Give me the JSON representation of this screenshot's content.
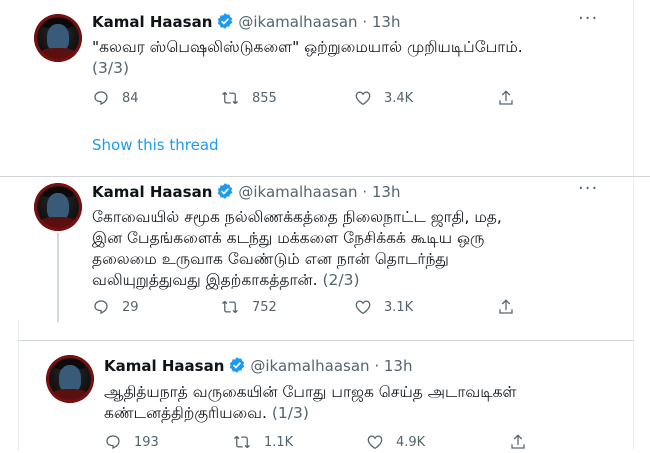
{
  "tweets": [
    {
      "name": "Kamal Haasan",
      "handle": "@ikamalhaasan",
      "time": "13h",
      "lines": [
        "\"கலவர ஸ்பெஷலிஸ்டுகளை\" ஒற்றுமையால் முறியடிப்போம்."
      ],
      "counter": "(3/3)",
      "replies": "84",
      "retweets": "855",
      "likes": "3.4K",
      "show_thread": "Show this thread"
    },
    {
      "name": "Kamal Haasan",
      "handle": "@ikamalhaasan",
      "time": "13h",
      "lines": [
        "கோவையில் சமூக நல்லிணக்கத்தை நிலைநாட்ட ஜாதி, மத,",
        "இன பேதங்களைக் கடந்து மக்களை நேசிக்கக் கூடிய ஒரு",
        "தலைமை உருவாக வேண்டும் என நான் தொடர்ந்து",
        "வலியுறுத்துவது இதற்காகத்தான்."
      ],
      "counter": "(2/3)",
      "replies": "29",
      "retweets": "752",
      "likes": "3.1K"
    },
    {
      "name": "Kamal Haasan",
      "handle": "@ikamalhaasan",
      "time": "13h",
      "lines": [
        "ஆதித்யநாத் வருகையின் போது பாஜக செய்த அடாவடிகள்",
        "கண்டனத்திற்குரியவை."
      ],
      "counter": "(1/3)",
      "replies": "193",
      "retweets": "1.1K",
      "likes": "4.9K"
    }
  ],
  "icons": {
    "verified": "verified-badge-icon",
    "more": "more-options-icon",
    "reply": "reply-icon",
    "retweet": "retweet-icon",
    "like": "like-icon",
    "share": "share-icon"
  },
  "colors": {
    "text": "#0f1419",
    "secondary": "#536471",
    "link": "#1d9bf0",
    "verified": "#1d9bf0"
  }
}
